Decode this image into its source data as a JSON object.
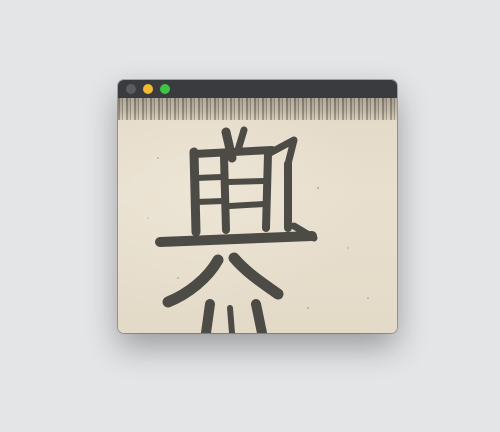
{
  "window": {
    "buttons": [
      {
        "name": "close",
        "color": "#5b5c60"
      },
      {
        "name": "minimize",
        "color": "#f2b931"
      },
      {
        "name": "maximize",
        "color": "#3ec447"
      }
    ]
  },
  "content": {
    "image_kind": "calligraphy-rubbing",
    "ink_color": "#4c4a45",
    "paper_color": "#e5dccb"
  }
}
